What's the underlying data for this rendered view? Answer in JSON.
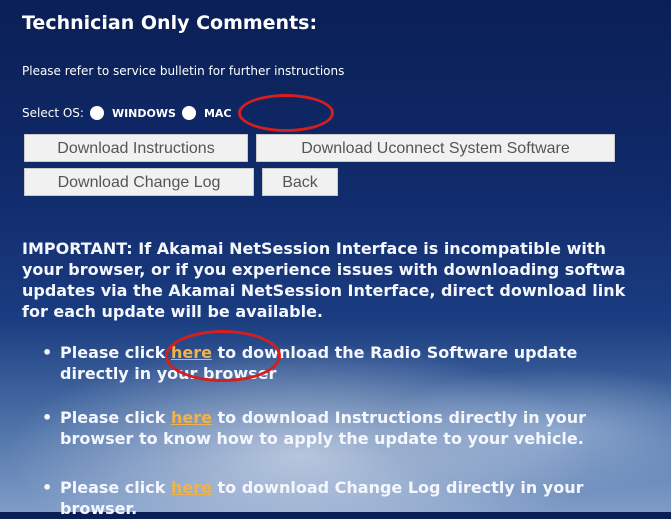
{
  "header": {
    "title": "Technician Only Comments:"
  },
  "refer_text": "Please refer to service bulletin for further instructions",
  "os_select": {
    "label": "Select OS:",
    "options": [
      "WINDOWS",
      "MAC"
    ]
  },
  "buttons": {
    "download_instructions": "Download Instructions",
    "download_software": "Download Uconnect System Software",
    "download_change_log": "Download Change Log",
    "back": "Back"
  },
  "important": {
    "lines": [
      "IMPORTANT: If Akamai NetSession Interface is incompatible with",
      "your browser, or if you experience issues with downloading softwa",
      "updates via the Akamai NetSession Interface, direct download link",
      "for each update will be available."
    ]
  },
  "bullets": [
    {
      "bullet": "•",
      "before": "Please click ",
      "link": "here",
      "after": " to download the Radio Software update",
      "line2": "directly in your browser"
    },
    {
      "bullet": "•",
      "before": "Please click ",
      "link": "here",
      "after": " to download Instructions directly in your",
      "line2": "browser to know how to apply the update to your vehicle."
    },
    {
      "bullet": "•",
      "before": "Please click ",
      "link": "here",
      "after": " to download Change Log directly in your",
      "line2": "browser."
    }
  ],
  "colors": {
    "link": "#f2b24b",
    "annotation_circle": "#d41f1f",
    "button_bg": "#f1f1f1"
  }
}
